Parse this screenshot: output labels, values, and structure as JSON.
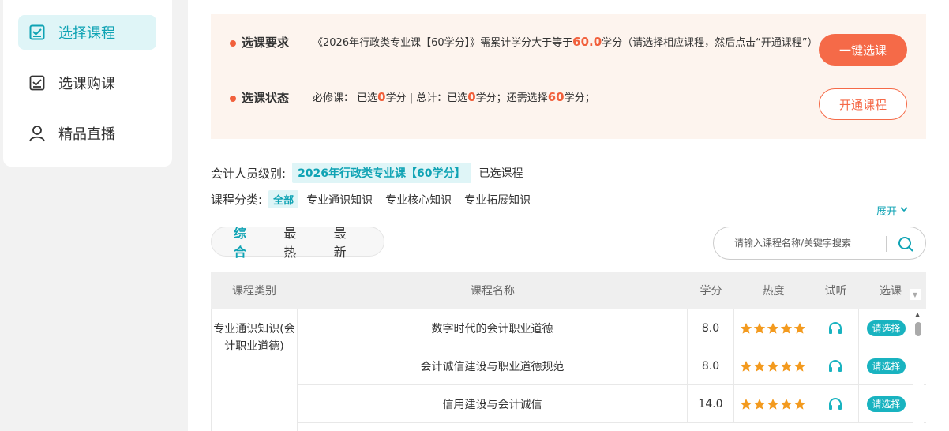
{
  "sidebar": {
    "items": [
      {
        "label": "选择课程",
        "icon": "checkbox-icon",
        "active": true
      },
      {
        "label": "选课购课",
        "icon": "checkbox-icon",
        "active": false
      },
      {
        "label": "精品直播",
        "icon": "user-icon",
        "active": false
      }
    ]
  },
  "requirements": {
    "label1": "选课要求",
    "text1_a": "《2026年行政类专业课【60学分】》需累计学分大于等于",
    "text1_hl": "60.0",
    "text1_b": "学分（请选择相应课程，然后点击“开通课程”）",
    "label2": "选课状态",
    "status": {
      "required_prefix": "必修课：  已选",
      "required_value": "0",
      "required_suffix": "学分 | 总计：已选",
      "total_value": "0",
      "total_suffix": "学分；还需选择",
      "remain_value": "60",
      "remain_suffix": "学分；"
    },
    "onekey_label": "一键选课",
    "open_label": "开通课程"
  },
  "filters": {
    "level_label": "会计人员级别:",
    "level_value": "2026年行政类专业课【60学分】",
    "selected_label": "已选课程",
    "category_label": "课程分类:",
    "categories": [
      "全部",
      "专业通识知识",
      "专业核心知识",
      "专业拓展知识"
    ],
    "expand_label": "展开"
  },
  "sort": {
    "items": [
      "综合",
      "最热",
      "最新"
    ]
  },
  "search": {
    "placeholder": "请输入课程名称/关键字搜索"
  },
  "table": {
    "headers": {
      "type": "课程类别",
      "name": "课程名称",
      "credit": "学分",
      "heat": "热度",
      "listen": "试听",
      "pick": "选课"
    },
    "group_label": "专业通识知识(会计职业道德)",
    "rows": [
      {
        "name": "数字时代的会计职业道德",
        "credit": "8.0",
        "stars": 5,
        "pick": "请选择"
      },
      {
        "name": "会计诚信建设与职业道德规范",
        "credit": "8.0",
        "stars": 5,
        "pick": "请选择"
      },
      {
        "name": "信用建设与会计诚信",
        "credit": "14.0",
        "stars": 5,
        "pick": "请选择"
      }
    ]
  },
  "colors": {
    "accent": "#0fa3b4",
    "orange": "#f56a48",
    "star": "#f39a1e"
  }
}
